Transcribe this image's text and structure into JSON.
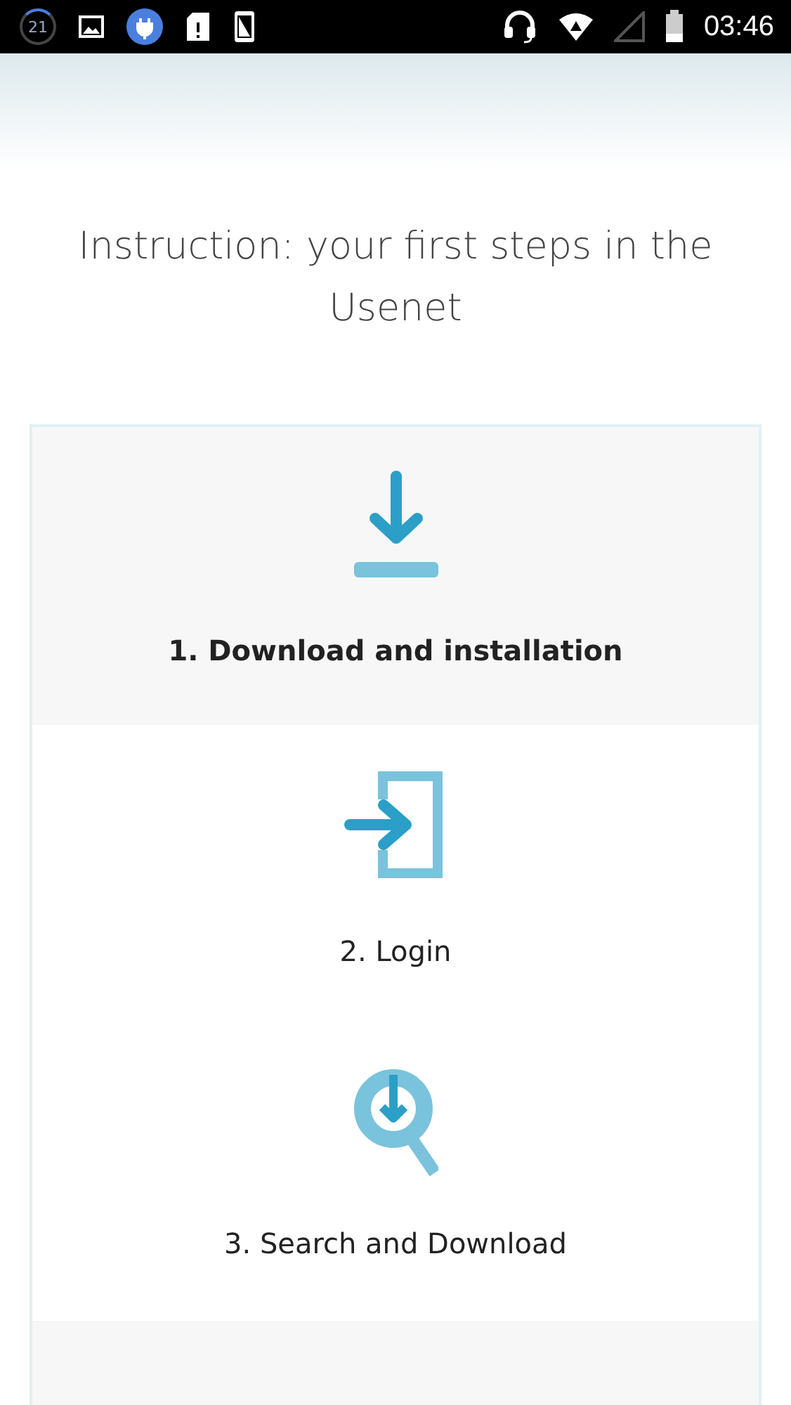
{
  "status_bar": {
    "notification_count": "21",
    "time": "03:46"
  },
  "title": "Instruction: your first steps in the Usenet",
  "steps": [
    {
      "kind": "download",
      "label": "1. Download and installation",
      "selected": true
    },
    {
      "kind": "login",
      "label": "2. Login",
      "selected": false
    },
    {
      "kind": "search",
      "label": "3. Search and Download",
      "selected": false
    }
  ]
}
